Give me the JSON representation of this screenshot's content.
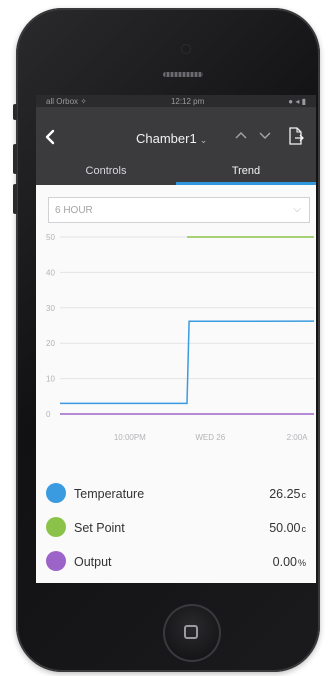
{
  "status_bar": {
    "carrier": "all Orbox ✧",
    "time": "12:12 pm",
    "battery": "● ◂ ▮"
  },
  "nav": {
    "title": "Chamber1",
    "back_icon": "back-chevron-icon",
    "export_icon": "export-icon"
  },
  "tabs": [
    {
      "label": "Controls",
      "active": false
    },
    {
      "label": "Trend",
      "active": true
    }
  ],
  "range_select": {
    "value": "6 HOUR"
  },
  "chart_data": {
    "type": "line",
    "ylim": [
      0,
      50
    ],
    "yticks": [
      "0",
      "10",
      "20",
      "30",
      "40",
      "50"
    ],
    "x_ticks": [
      "10:00PM",
      "WED 26",
      "2:00A"
    ],
    "xlim": [
      0,
      6
    ],
    "x_tick_positions": [
      1.65,
      3.55,
      5.6
    ],
    "grid": true,
    "series": [
      {
        "name": "Temperature",
        "color": "#3a9be0",
        "x": [
          0,
          3.0,
          3.05,
          6
        ],
        "y": [
          3.0,
          3.0,
          26.2,
          26.25
        ]
      },
      {
        "name": "Set Point",
        "color": "#8bc34a",
        "x": [
          3.0,
          6
        ],
        "y": [
          50,
          50
        ]
      },
      {
        "name": "Output",
        "color": "#9c64c8",
        "x": [
          0,
          6
        ],
        "y": [
          0,
          0
        ]
      }
    ]
  },
  "legend": [
    {
      "name": "Temperature",
      "value": "26.25",
      "unit": "c",
      "color": "#3a9be0"
    },
    {
      "name": "Set Point",
      "value": "50.00",
      "unit": "c",
      "color": "#8bc34a"
    },
    {
      "name": "Output",
      "value": "0.00",
      "unit": "%",
      "color": "#9c64c8"
    }
  ]
}
